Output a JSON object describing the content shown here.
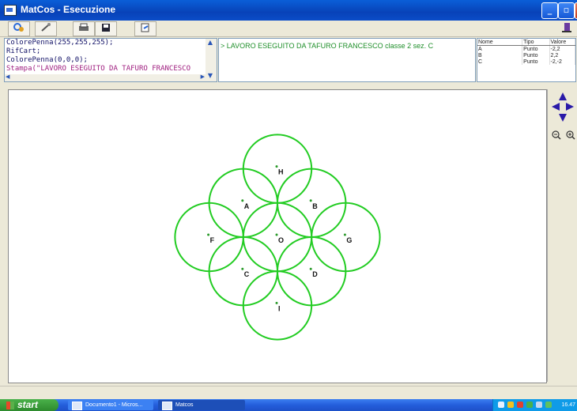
{
  "window": {
    "title": "MatCos - Esecuzione",
    "controls": {
      "minimize": "_",
      "maximize": "▫",
      "close": "×"
    }
  },
  "toolbar": {
    "buttons": [
      "run-icon",
      "tools-icon",
      "print-icon",
      "save-icon",
      "export-icon"
    ],
    "exit": "exit-icon"
  },
  "code": {
    "lines": [
      "ColorePenna(255,255,255);",
      "RifCart;",
      "ColorePenna(0,0,0);",
      "Stampa(\"LAVORO ESEGUITO DA TAFURO FRANCESCO"
    ]
  },
  "output": {
    "text": "> LAVORO ESEGUITO DA TAFURO FRANCESCO classe 2 sez. C"
  },
  "variables": {
    "headers": [
      "Nome",
      "Tipo",
      "Valore"
    ],
    "rows": [
      {
        "name": "A",
        "type": "Punto",
        "value": "-2,2"
      },
      {
        "name": "B",
        "type": "Punto",
        "value": "2,2"
      },
      {
        "name": "C",
        "type": "Punto",
        "value": "-2,-2"
      }
    ]
  },
  "drawing": {
    "circle_color": "#22cc22",
    "point_color": "#2a9a2a",
    "circle_radius": 4,
    "points": [
      {
        "label": "H",
        "x": 0,
        "y": 8
      },
      {
        "label": "A",
        "x": -4,
        "y": 4
      },
      {
        "label": "B",
        "x": 4,
        "y": 4
      },
      {
        "label": "F",
        "x": -8,
        "y": 0
      },
      {
        "label": "O",
        "x": 0,
        "y": 0
      },
      {
        "label": "G",
        "x": 8,
        "y": 0
      },
      {
        "label": "C",
        "x": -4,
        "y": -4
      },
      {
        "label": "D",
        "x": 4,
        "y": -4
      },
      {
        "label": "I",
        "x": 0,
        "y": -8
      }
    ]
  },
  "side_panel": {
    "nav": [
      "up-arrow-icon",
      "left-arrow-icon",
      "right-arrow-icon",
      "down-arrow-icon"
    ],
    "zoom": [
      "zoom-out-icon",
      "zoom-in-icon"
    ]
  },
  "taskbar": {
    "start_label": "start",
    "tasks": [
      "Documento1 - Micros...",
      "Matcos"
    ],
    "clock": "16.47"
  }
}
